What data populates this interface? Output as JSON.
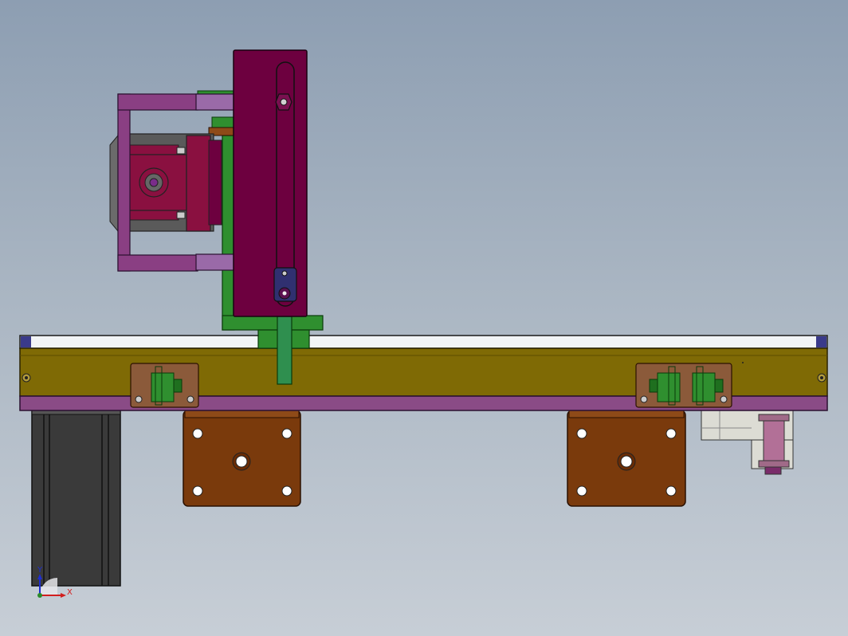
{
  "window": {
    "title": ""
  },
  "viewport": {
    "background_top": "#8d9eb2",
    "background_bottom": "#c7ced6"
  },
  "triad": {
    "x_label": "X",
    "y_label": "Y",
    "x_color": "#d21e1e",
    "y_color": "#1e2ed2"
  },
  "model": {
    "part_colors": {
      "rail_top_frame": "#1a1a1a",
      "rail_olive": "#7f6a05",
      "rail_purple": "#8a4b86",
      "slider_plate": "#6d003f",
      "bracket_purple": "#8a3f83",
      "green_mount": "#2f8f2f",
      "motor_body": "#3c3c3c",
      "brown_block": "#7a3a0c",
      "gray_block": "#d8d8d2"
    },
    "icons": [
      "cad-model-icon",
      "coordinate-triad-icon"
    ]
  }
}
